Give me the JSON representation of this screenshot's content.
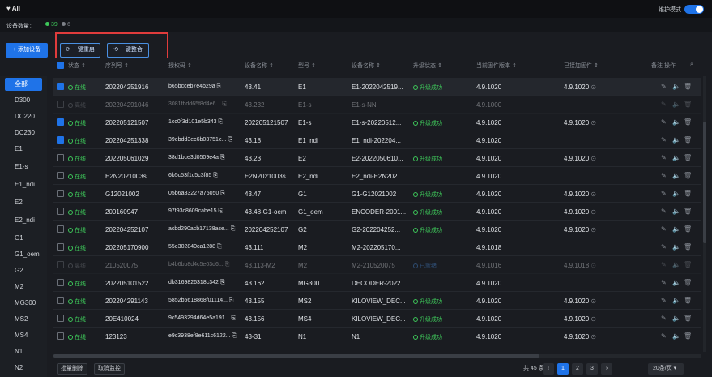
{
  "header": {
    "title": "All",
    "mode_label": "维护模式"
  },
  "countbar": {
    "label": "设备数量：",
    "online": "39",
    "offline": "6"
  },
  "toolbar": {
    "add_label": "+ 添加设备",
    "upgrade_label": "一键重启",
    "reboot_label": "一键整合"
  },
  "sidebar": {
    "items": [
      "全部",
      "D300",
      "DC220",
      "DC230",
      "E1",
      "E1-s",
      "E1_ndi",
      "E2",
      "E2_ndi",
      "G1",
      "G1_oem",
      "G2",
      "M2",
      "MG300",
      "MS2",
      "MS4",
      "N1",
      "N2"
    ]
  },
  "table": {
    "headers": [
      "状态 ⇕",
      "序列号 ⇕",
      "授权码 ⇕",
      "设备名称 ⇕",
      "型号 ⇕",
      "设备名称 ⇕",
      "升级状态 ⇕",
      "当前固件版本 ⇕",
      "已接加固件 ⇕",
      "备注 操作"
    ],
    "rows": [
      {
        "status": "在线",
        "serial": "202204251916",
        "auth": "b65bcceb7e4b29a",
        "name": "43.41",
        "model": "E1",
        "dev": "E1-2022042519...",
        "upg": "升级成功",
        "ver": "4.9.1020",
        "fw": "4.9.1020"
      },
      {
        "status": "离线",
        "serial": "202204291046",
        "auth": "3081fbdd65f8d4e6...",
        "name": "43.232",
        "model": "E1-s",
        "dev": "E1-s-NN",
        "upg": "",
        "ver": "4.9.1000",
        "fw": ""
      },
      {
        "status": "在线",
        "serial": "202205121507",
        "auth": "1cc0f3d101e5b343",
        "name": "202205121507",
        "model": "E1-s",
        "dev": "E1-s-20220512...",
        "upg": "升级成功",
        "ver": "4.9.1020",
        "fw": "4.9.1020"
      },
      {
        "status": "在线",
        "serial": "202204251338",
        "auth": "39ebdd3ec6b03751e...",
        "name": "43.18",
        "model": "E1_ndi",
        "dev": "E1_ndi-202204...",
        "upg": "",
        "ver": "4.9.1020",
        "fw": ""
      },
      {
        "status": "在线",
        "serial": "202205061029",
        "auth": "38d1bce3d0509e4a",
        "name": "43.23",
        "model": "E2",
        "dev": "E2-2022050610...",
        "upg": "升级成功",
        "ver": "4.9.1020",
        "fw": "4.9.1020"
      },
      {
        "status": "在线",
        "serial": "E2N2021003s",
        "auth": "6b5c53f1c5c3f85",
        "name": "E2N2021003s",
        "model": "E2_ndi",
        "dev": "E2_ndi-E2N202...",
        "upg": "",
        "ver": "4.9.1020",
        "fw": ""
      },
      {
        "status": "在线",
        "serial": "G12021002",
        "auth": "05b6a83227a75050",
        "name": "43.47",
        "model": "G1",
        "dev": "G1-G12021002",
        "upg": "升级成功",
        "ver": "4.9.1020",
        "fw": "4.9.1020"
      },
      {
        "status": "在线",
        "serial": "200160947",
        "auth": "97f93c8609cabe15",
        "name": "43.48-G1-oem",
        "model": "G1_oem",
        "dev": "ENCODER-2001...",
        "upg": "升级成功",
        "ver": "4.9.1020",
        "fw": "4.9.1020"
      },
      {
        "status": "在线",
        "serial": "202204252107",
        "auth": "acbd290acb17138ace...",
        "name": "202204252107",
        "model": "G2",
        "dev": "G2-202204252...",
        "upg": "升级成功",
        "ver": "4.9.1020",
        "fw": "4.9.1020"
      },
      {
        "status": "在线",
        "serial": "202205170900",
        "auth": "55e302840ca1288",
        "name": "43.111",
        "model": "M2",
        "dev": "M2-202205170...",
        "upg": "",
        "ver": "4.9.1018",
        "fw": ""
      },
      {
        "status": "离线",
        "serial": "210520075",
        "auth": "b4b6bb8d4c5e03d6...",
        "name": "43.113-M2",
        "model": "M2",
        "dev": "M2-210520075",
        "upg": "已就绪",
        "ver": "4.9.1016",
        "fw": "4.9.1018"
      },
      {
        "status": "在线",
        "serial": "202205101522",
        "auth": "db3169826318c342",
        "name": "43.162",
        "model": "MG300",
        "dev": "DECODER-2022...",
        "upg": "",
        "ver": "4.9.1020",
        "fw": ""
      },
      {
        "status": "在线",
        "serial": "202204291143",
        "auth": "5852b5618868f01114...",
        "name": "43.155",
        "model": "MS2",
        "dev": "KILOVIEW_DEC...",
        "upg": "升级成功",
        "ver": "4.9.1020",
        "fw": "4.9.1020"
      },
      {
        "status": "在线",
        "serial": "20E410024",
        "auth": "9c5493294d64e5a191...",
        "name": "43.156",
        "model": "MS4",
        "dev": "KILOVIEW_DEC...",
        "upg": "升级成功",
        "ver": "4.9.1020",
        "fw": "4.9.1020"
      },
      {
        "status": "在线",
        "serial": "123123",
        "auth": "e9c3938ef8e611c6122...",
        "name": "43-31",
        "model": "N1",
        "dev": "N1",
        "upg": "升级成功",
        "ver": "4.9.1020",
        "fw": "4.9.1020"
      }
    ]
  },
  "footer": {
    "batch_delete": "批量删除",
    "cancel_monitor": "取消监控",
    "total": "共 45 条",
    "pages": [
      "1",
      "2",
      "3"
    ],
    "page_size": "20条/页"
  }
}
